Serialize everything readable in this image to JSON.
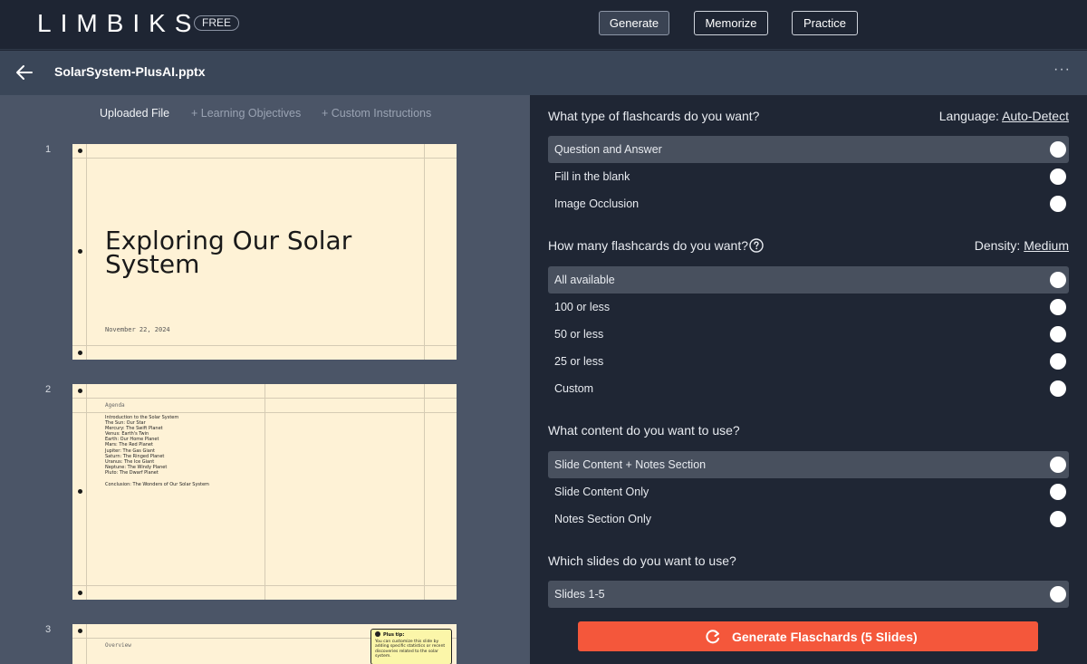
{
  "nav": {
    "logo": "LIMBIKS",
    "badge": "FREE",
    "buttons": [
      "Generate",
      "Memorize",
      "Practice"
    ]
  },
  "file": {
    "name": "SolarSystem-PlusAI.pptx"
  },
  "left": {
    "tabs": [
      "Uploaded File",
      "+ Learning Objectives",
      "+ Custom Instructions"
    ],
    "slides": [
      {
        "num": "1",
        "title": "Exploring Our Solar System",
        "date": "November 22, 2024"
      },
      {
        "num": "2",
        "heading": "Agenda",
        "items": [
          "Introduction to the Solar System",
          "The Sun: Our Star",
          "Mercury: The Swift Planet",
          "Venus: Earth's Twin",
          "Earth: Our Home Planet",
          "Mars: The Red Planet",
          "Jupiter: The Gas Giant",
          "Saturn: The Ringed Planet",
          "Uranus: The Ice Giant",
          "Neptune: The Windy Planet",
          "Pluto: The Dwarf Planet"
        ],
        "conclusion": "Conclusion: The Wonders of Our Solar System"
      },
      {
        "num": "3",
        "heading": "Overview",
        "tip_title": "Plus tip:",
        "tip_body": "You can customize this slide by adding specific statistics or recent discoveries related to the solar system."
      }
    ]
  },
  "right": {
    "type": {
      "question": "What type of flashcards do you want?",
      "aux_label": "Language: ",
      "aux_link": "Auto-Detect",
      "options": [
        "Question and Answer",
        "Fill in the blank",
        "Image Occlusion"
      ]
    },
    "count": {
      "question": "How many flashcards do you want?",
      "aux_label": "Density: ",
      "aux_link": "Medium",
      "options": [
        "All available",
        "100 or less",
        "50 or less",
        "25 or less",
        "Custom"
      ]
    },
    "content": {
      "question": "What content do you want to use?",
      "options": [
        "Slide Content + Notes Section",
        "Slide Content Only",
        "Notes Section Only"
      ]
    },
    "slides": {
      "question": "Which slides do you want to use?",
      "options": [
        "Slides 1-5"
      ]
    },
    "cta": "Generate Flaschards (5 Slides)"
  },
  "colors": {
    "cta": "#f4573b",
    "selected_row": "#48505e",
    "left_panel": "#4b5567",
    "slide_bg": "#fef2d6"
  }
}
